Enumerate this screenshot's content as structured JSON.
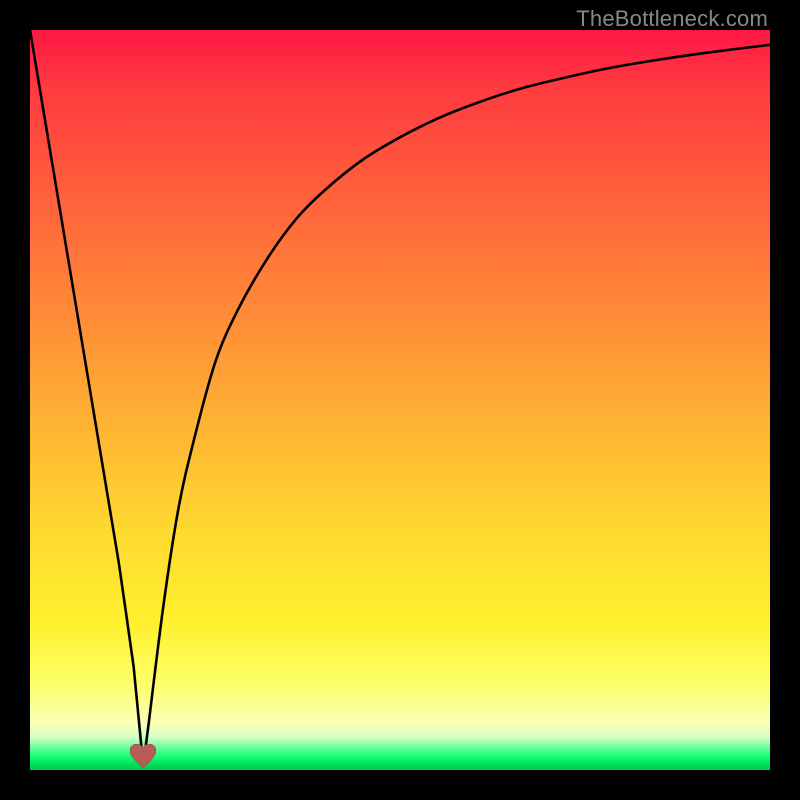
{
  "watermark": "TheBottleneck.com",
  "chart_data": {
    "type": "line",
    "title": "",
    "xlabel": "",
    "ylabel": "",
    "xlim": [
      0,
      100
    ],
    "ylim": [
      0,
      100
    ],
    "series": [
      {
        "name": "bottleneck-curve",
        "x": [
          0,
          2,
          4,
          6,
          8,
          10,
          12,
          14,
          15.3,
          16,
          18,
          20,
          22,
          25,
          28,
          32,
          36,
          40,
          45,
          50,
          55,
          60,
          66,
          72,
          78,
          85,
          92,
          100
        ],
        "y": [
          100,
          88,
          76,
          64,
          52,
          40,
          28,
          14,
          0,
          6,
          22,
          35,
          44,
          55,
          62,
          69,
          74.5,
          78.5,
          82.5,
          85.5,
          88,
          90,
          92,
          93.5,
          94.8,
          96,
          97,
          98
        ]
      }
    ],
    "marker": {
      "x": 15.3,
      "y": 0,
      "shape": "heart",
      "color": "#b85c57"
    },
    "background_gradient": {
      "top": "#ff1744",
      "middle": "#ffe13a",
      "bottom_band": "#00c853"
    }
  }
}
